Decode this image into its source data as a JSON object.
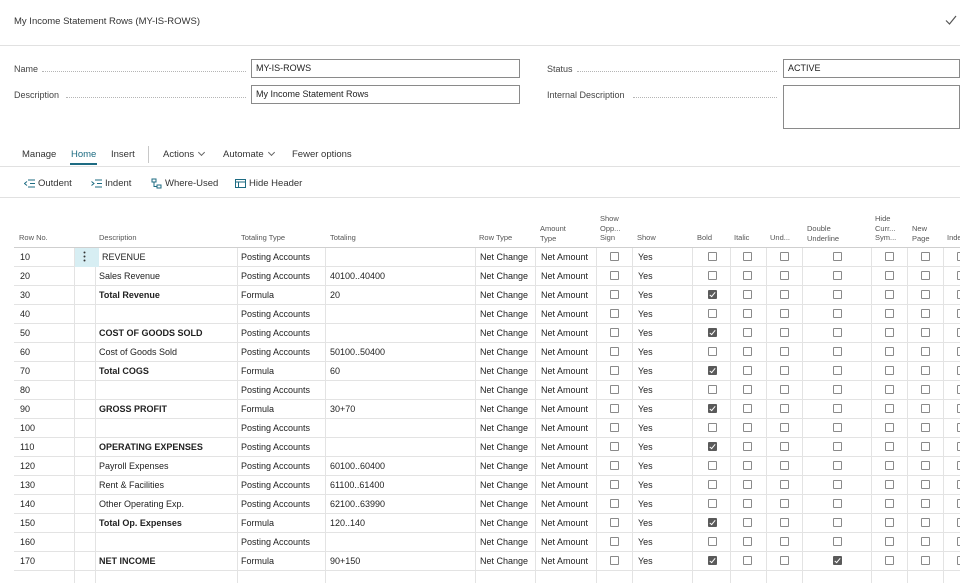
{
  "page": {
    "title": "My Income Statement Rows (MY-IS-ROWS)"
  },
  "fields": {
    "name_label": "Name",
    "name_value": "MY-IS-ROWS",
    "description_label": "Description",
    "description_value": "My Income Statement Rows",
    "status_label": "Status",
    "status_value": "ACTIVE",
    "internal_description_label": "Internal Description",
    "internal_description_value": ""
  },
  "actionbar": {
    "manage": "Manage",
    "home": "Home",
    "insert": "Insert",
    "actions": "Actions",
    "automate": "Automate",
    "fewer_options": "Fewer options"
  },
  "toolbar": {
    "outdent": "Outdent",
    "indent": "Indent",
    "where_used": "Where-Used",
    "hide_header": "Hide Header"
  },
  "columns": {
    "row_no": "Row No.",
    "description": "Description",
    "totaling_type": "Totaling Type",
    "totaling": "Totaling",
    "row_type": "Row Type",
    "amount_type_1": "Amount",
    "amount_type_2": "Type",
    "show_opp_1": "Show",
    "show_opp_2": "Opp...",
    "show_opp_3": "Sign",
    "show": "Show",
    "bold": "Bold",
    "italic": "Italic",
    "underline": "Und...",
    "double_underline_1": "Double",
    "double_underline_2": "Underline",
    "hide_currency_1": "Hide",
    "hide_currency_2": "Curr...",
    "hide_currency_3": "Sym...",
    "new_page_1": "New",
    "new_page_2": "Page",
    "indentation": "Inde"
  },
  "rows": [
    {
      "no": "10",
      "desc": "REVENUE",
      "ttype": "Posting Accounts",
      "totaling": "",
      "rtype": "Net Change",
      "atype": "Net Amount",
      "show": "Yes",
      "bold": false,
      "dbl": false,
      "b": false
    },
    {
      "no": "20",
      "desc": "Sales Revenue",
      "ttype": "Posting Accounts",
      "totaling": "40100..40400",
      "rtype": "Net Change",
      "atype": "Net Amount",
      "show": "Yes",
      "bold": false,
      "dbl": false,
      "b": false
    },
    {
      "no": "30",
      "desc": "Total Revenue",
      "ttype": "Formula",
      "totaling": "20",
      "rtype": "Net Change",
      "atype": "Net Amount",
      "show": "Yes",
      "bold": true,
      "dbl": false,
      "b": true
    },
    {
      "no": "40",
      "desc": "",
      "ttype": "Posting Accounts",
      "totaling": "",
      "rtype": "Net Change",
      "atype": "Net Amount",
      "show": "Yes",
      "bold": false,
      "dbl": false,
      "b": false
    },
    {
      "no": "50",
      "desc": "COST OF GOODS SOLD",
      "ttype": "Posting Accounts",
      "totaling": "",
      "rtype": "Net Change",
      "atype": "Net Amount",
      "show": "Yes",
      "bold": true,
      "dbl": false,
      "b": true
    },
    {
      "no": "60",
      "desc": "Cost of Goods Sold",
      "ttype": "Posting Accounts",
      "totaling": "50100..50400",
      "rtype": "Net Change",
      "atype": "Net Amount",
      "show": "Yes",
      "bold": false,
      "dbl": false,
      "b": false
    },
    {
      "no": "70",
      "desc": "Total COGS",
      "ttype": "Formula",
      "totaling": "60",
      "rtype": "Net Change",
      "atype": "Net Amount",
      "show": "Yes",
      "bold": true,
      "dbl": false,
      "b": true
    },
    {
      "no": "80",
      "desc": "",
      "ttype": "Posting Accounts",
      "totaling": "",
      "rtype": "Net Change",
      "atype": "Net Amount",
      "show": "Yes",
      "bold": false,
      "dbl": false,
      "b": false
    },
    {
      "no": "90",
      "desc": "GROSS PROFIT",
      "ttype": "Formula",
      "totaling": "30+70",
      "rtype": "Net Change",
      "atype": "Net Amount",
      "show": "Yes",
      "bold": true,
      "dbl": false,
      "b": true
    },
    {
      "no": "100",
      "desc": "",
      "ttype": "Posting Accounts",
      "totaling": "",
      "rtype": "Net Change",
      "atype": "Net Amount",
      "show": "Yes",
      "bold": false,
      "dbl": false,
      "b": false
    },
    {
      "no": "110",
      "desc": "OPERATING EXPENSES",
      "ttype": "Posting Accounts",
      "totaling": "",
      "rtype": "Net Change",
      "atype": "Net Amount",
      "show": "Yes",
      "bold": true,
      "dbl": false,
      "b": true
    },
    {
      "no": "120",
      "desc": "Payroll Expenses",
      "ttype": "Posting Accounts",
      "totaling": "60100..60400",
      "rtype": "Net Change",
      "atype": "Net Amount",
      "show": "Yes",
      "bold": false,
      "dbl": false,
      "b": false
    },
    {
      "no": "130",
      "desc": "Rent & Facilities",
      "ttype": "Posting Accounts",
      "totaling": "61100..61400",
      "rtype": "Net Change",
      "atype": "Net Amount",
      "show": "Yes",
      "bold": false,
      "dbl": false,
      "b": false
    },
    {
      "no": "140",
      "desc": "Other Operating Exp.",
      "ttype": "Posting Accounts",
      "totaling": "62100..63990",
      "rtype": "Net Change",
      "atype": "Net Amount",
      "show": "Yes",
      "bold": false,
      "dbl": false,
      "b": false
    },
    {
      "no": "150",
      "desc": "Total Op. Expenses",
      "ttype": "Formula",
      "totaling": "120..140",
      "rtype": "Net Change",
      "atype": "Net Amount",
      "show": "Yes",
      "bold": true,
      "dbl": false,
      "b": true
    },
    {
      "no": "160",
      "desc": "",
      "ttype": "Posting Accounts",
      "totaling": "",
      "rtype": "Net Change",
      "atype": "Net Amount",
      "show": "Yes",
      "bold": false,
      "dbl": false,
      "b": false
    },
    {
      "no": "170",
      "desc": "NET INCOME",
      "ttype": "Formula",
      "totaling": "90+150",
      "rtype": "Net Change",
      "atype": "Net Amount",
      "show": "Yes",
      "bold": true,
      "dbl": true,
      "b": true
    }
  ]
}
